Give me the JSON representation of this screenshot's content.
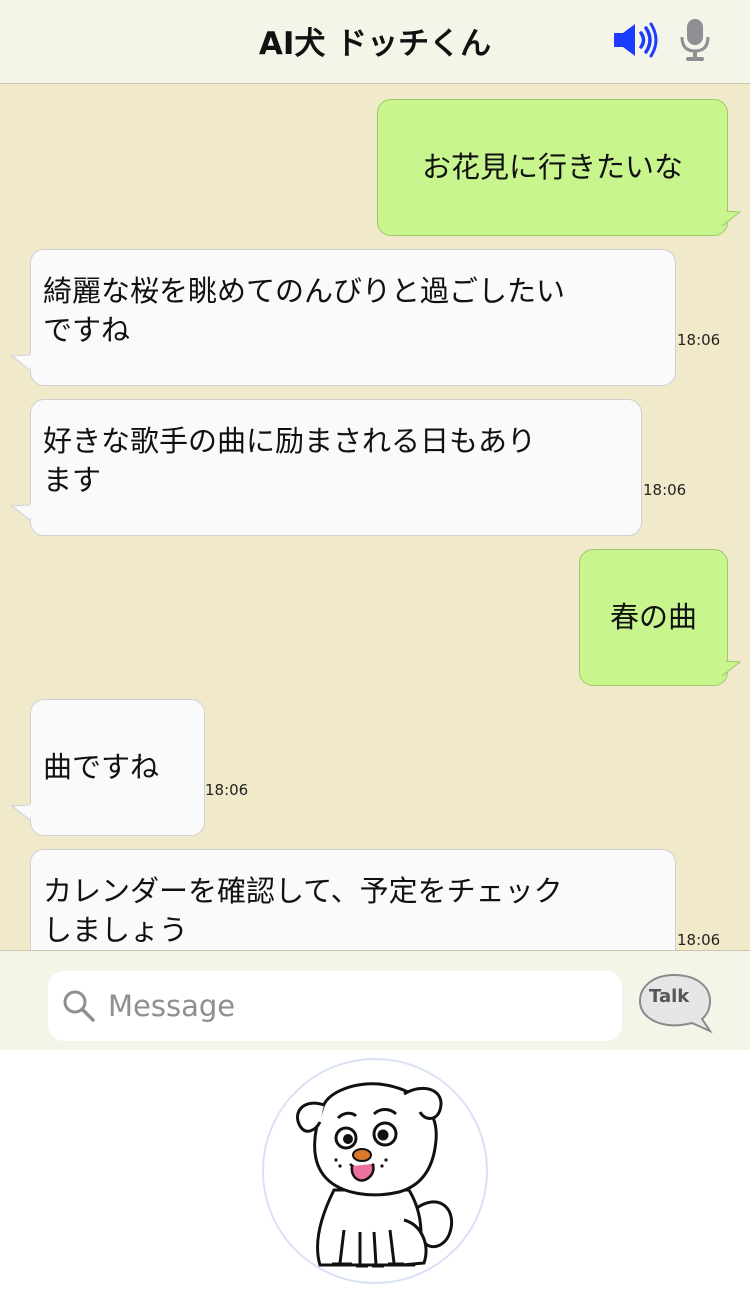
{
  "header": {
    "title": "AI犬 ドッチくん",
    "speaker_icon": "speaker-icon",
    "mic_icon": "mic-icon",
    "speaker_color": "#1a3cff",
    "mic_color": "#8e8e93"
  },
  "chat": {
    "background": "#f0eacb",
    "user_bubble_color": "#c9f58f",
    "bot_bubble_color": "#fafafa",
    "messages": [
      {
        "sender": "user",
        "text": "お花見に行きたいな"
      },
      {
        "sender": "bot",
        "lines": [
          "綺麗な桜を眺めてのんびりと過ごしたい",
          "ですね"
        ],
        "time": "18:06"
      },
      {
        "sender": "bot",
        "lines": [
          "好きな歌手の曲に励まされる日もあり",
          "ます"
        ],
        "time": "18:06"
      },
      {
        "sender": "user",
        "text": "春の曲"
      },
      {
        "sender": "bot",
        "lines": [
          "曲ですね"
        ],
        "time": "18:06"
      },
      {
        "sender": "bot",
        "lines": [
          "カレンダーを確認して、予定をチェック",
          "しましょう"
        ],
        "time": "18:06"
      }
    ]
  },
  "input": {
    "placeholder": "Message",
    "value": "",
    "search_icon": "search-icon",
    "talk_label": "Talk"
  },
  "avatar": {
    "icon": "dog-mascot-icon"
  }
}
